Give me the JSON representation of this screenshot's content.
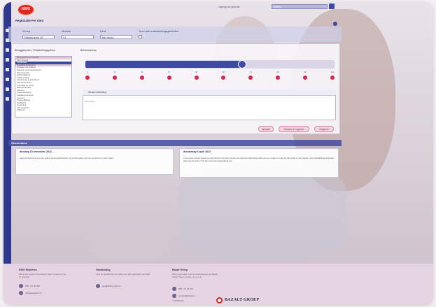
{
  "header": {
    "logo": "KEKI",
    "account_text": "Ingelogd als gebruiker",
    "search_text": "Zoeken",
    "page_title": "Registratie Per Kind"
  },
  "filters": {
    "group_label": "Groep",
    "group_value": "Dolfijnen groep 1/2",
    "module_label": "Module",
    "module_value": "K1",
    "child_label": "Kind",
    "child_value": "Bob Jansen",
    "show_all_label": "Toon alle ontwikkelingsgebieden"
  },
  "panel": {
    "tree_label": "Bevaggebieden / Ontwikkelingsgebied",
    "tree_items": [
      {
        "label": "Bewegen/Groot-motoriek",
        "state": "hl"
      },
      {
        "label": "Fijn-motoriek",
        "state": "normal"
      },
      {
        "label": "Spraak/taal",
        "state": "sel"
      },
      {
        "label": "Ontwikkelingsstadium",
        "state": "hl"
      },
      {
        "label": "Omgaan met anderen",
        "state": "normal"
      },
      {
        "label": "Rekenen met hoeveelheden",
        "state": "normal"
      },
      {
        "label": "Woordenschat",
        "state": "normal"
      },
      {
        "label": "Zelfstandigheid",
        "state": "normal"
      },
      {
        "label": "Taalbewustzijn",
        "state": "normal"
      },
      {
        "label": "Ontluikende geletterdheid",
        "state": "normal"
      },
      {
        "label": "Zelfredzaamheid",
        "state": "normal"
      },
      {
        "label": "Oriëntatie op ruimte",
        "state": "normal"
      },
      {
        "label": "Wereldoriëntatie",
        "state": "normal"
      },
      {
        "label": "Tekenen",
        "state": "normal"
      },
      {
        "label": "Spelontwikkeling",
        "state": "normal"
      },
      {
        "label": "Sociaal-emotioneel",
        "state": "normal"
      },
      {
        "label": "Luisteren",
        "state": "normal"
      },
      {
        "label": "Persoonlijkheid",
        "state": "normal"
      },
      {
        "label": "Tijdsbesef",
        "state": "normal"
      },
      {
        "label": "Creativiteit",
        "state": "normal"
      },
      {
        "label": "Samenwerken",
        "state": "normal"
      },
      {
        "label": "Zelfbeeld",
        "state": "normal"
      }
    ],
    "scale_label": "Beheersniveau",
    "scale_value_fraction": 0.63,
    "ticks": [
      "1",
      "13",
      "25",
      "37",
      "49",
      "62",
      "74",
      "86",
      "98",
      "110"
    ],
    "note_header": "Nieuwe toelichting",
    "note_placeholder": "Schrijf hier...",
    "buttons": [
      "Opslaan",
      "Opslaan & volgende",
      "Volgende"
    ]
  },
  "observations": {
    "title": "Observaties",
    "items": [
      {
        "date": "dinsdag 15 november 2022",
        "text": "Jaspers werkt heel fijn mee tijdens de kringactiviteiten. Hij vertelt graag over zijn weekend en stelt vragen."
      },
      {
        "date": "donderdag 6 april 2022",
        "text": "In de groep luistert Jaspers goed naar de instructie. Hij kan de opdracht zelfstandig uitvoeren en vraagt om hulp als dat nodig is. Het werken met ontwikkelingsmateriaal gaat steeds beter en hij laat veel nieuwsgierigheid zien."
      }
    ]
  },
  "footer": {
    "col1": {
      "title": "KEKI Helpdesk",
      "text": "Heb je een vraag of opmerking? Neem contact op met de helpdesk.",
      "phone": "088 - 00 00 000",
      "email": "helpdesk@keki.nl"
    },
    "col2": {
      "title": "Handleiding",
      "text": "Lees de handleiding voor uitleg over alle onderdelen van KEKI.",
      "link": "Handleiding openen"
    },
    "col3": {
      "title": "Bazalt Groep",
      "text": "Wil je meer weten over de ondersteuning van Bazalt Groep? Neem contact met ons op.",
      "phone": "088 - 00 00 000",
      "email": "contact@bazalt.nl",
      "copyright": "© 2023 Bazalt"
    },
    "brand": "BAZALT GROEP"
  }
}
